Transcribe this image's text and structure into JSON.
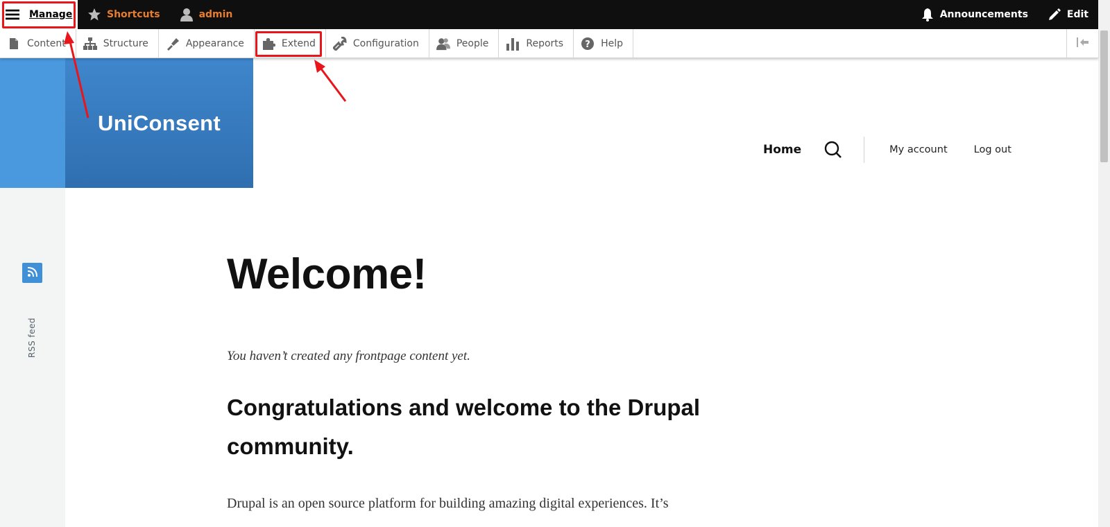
{
  "toolbar": {
    "manage_label": "Manage",
    "shortcuts_label": "Shortcuts",
    "user_label": "admin",
    "announcements_label": "Announcements",
    "edit_label": "Edit"
  },
  "tray": {
    "items": [
      {
        "label": "Content",
        "icon": "file-icon"
      },
      {
        "label": "Structure",
        "icon": "sitemap-icon"
      },
      {
        "label": "Appearance",
        "icon": "paintbrush-icon"
      },
      {
        "label": "Extend",
        "icon": "puzzle-icon"
      },
      {
        "label": "Configuration",
        "icon": "wrench-icon"
      },
      {
        "label": "People",
        "icon": "people-icon"
      },
      {
        "label": "Reports",
        "icon": "bar-chart-icon"
      },
      {
        "label": "Help",
        "icon": "help-icon"
      }
    ]
  },
  "site": {
    "name": "UniConsent"
  },
  "nav": {
    "home": "Home",
    "my_account": "My account",
    "log_out": "Log out"
  },
  "sidebar": {
    "rss_label": "RSS feed"
  },
  "main": {
    "title": "Welcome!",
    "empty_text": "You haven’t created any frontpage content yet.",
    "heading": "Congratulations and welcome to the Drupal community.",
    "paragraph": "Drupal is an open source platform for building amazing digital experiences. It’s"
  },
  "colors": {
    "toolbar_bg": "#0f0f0f",
    "accent_orange": "#e87d2c",
    "brand_blue": "#3f86cc",
    "annotation_red": "#e8161b"
  }
}
